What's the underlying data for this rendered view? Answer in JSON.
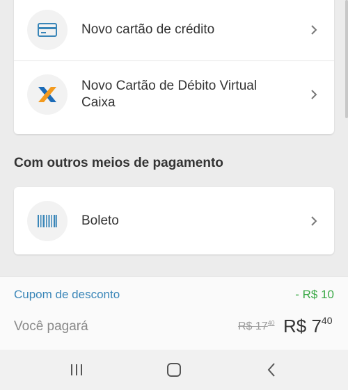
{
  "cards": {
    "credit_card_label": "Novo cartão de crédito",
    "caixa_label_line1": "Novo Cartão de Débito Virtual",
    "caixa_label_line2": "Caixa"
  },
  "section": {
    "other_methods_title": "Com outros meios de pagamento"
  },
  "boleto": {
    "label": "Boleto"
  },
  "summary": {
    "coupon_label": "Cupom de desconto",
    "coupon_value": "- R$ 10",
    "pay_label": "Você pagará",
    "old_price_main": "R$ 17",
    "old_price_cents": "40",
    "new_price_main": "R$ 7",
    "new_price_cents": "40"
  },
  "colors": {
    "link_blue": "#3a86b8",
    "discount_green": "#39a845",
    "caixa_blue": "#1c6bb7",
    "caixa_orange": "#f39a1e"
  },
  "icons": [
    "credit-card-icon",
    "caixa-logo-icon",
    "barcode-icon",
    "chevron-right-icon",
    "recent-apps-icon",
    "home-icon",
    "back-icon"
  ]
}
